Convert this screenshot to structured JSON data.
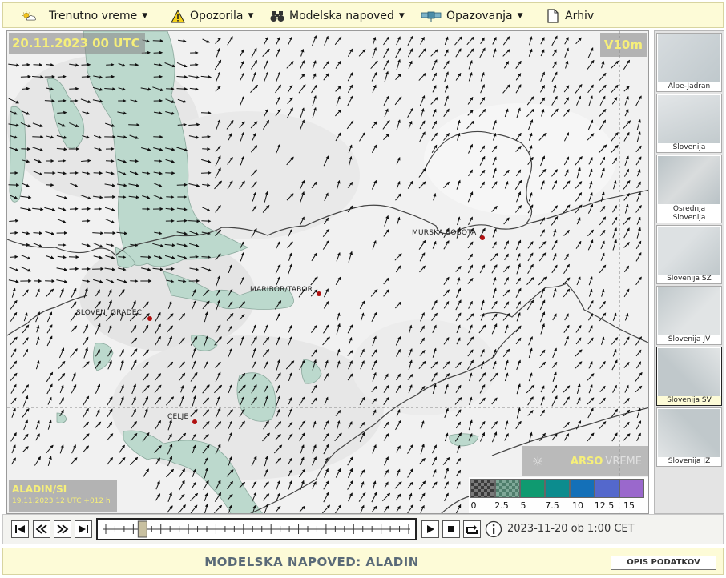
{
  "menu": {
    "items": [
      {
        "label": "Trenutno vreme",
        "icon": "weather-sun-cloud-icon",
        "dropdown": true
      },
      {
        "label": "Opozorila",
        "icon": "warning-triangle-icon",
        "dropdown": true
      },
      {
        "label": "Modelska napoved",
        "icon": "binoculars-icon",
        "dropdown": true
      },
      {
        "label": "Opazovanja",
        "icon": "observation-satellite-icon",
        "dropdown": true
      },
      {
        "label": "Arhiv",
        "icon": "document-icon",
        "dropdown": false
      }
    ]
  },
  "map": {
    "timestamp": "20.11.2023 00 UTC",
    "variable": "V10m",
    "model": "ALADIN/SI",
    "model_run": "19.11.2023 12 UTC +012 h",
    "logo_brand": "ARSO",
    "logo_word": "VREME",
    "cities": [
      "MURSKA SOBOTA",
      "MARIBOR/TABOR",
      "SLOVENJ GRADEC",
      "CELJE"
    ]
  },
  "legend": {
    "labels": [
      "0",
      "2.5",
      "5",
      "7.5",
      "10",
      "12.5",
      "15"
    ],
    "colors": [
      "#5a5a5a",
      "#5e8c7a",
      "#0f9a70",
      "#0c8c8e",
      "#1470b8",
      "#5468cc",
      "#9a68cc"
    ]
  },
  "thumbnails": [
    {
      "label": "Alpe-Jadran",
      "selected": false
    },
    {
      "label": "Slovenija",
      "selected": false
    },
    {
      "label": "Osrednja Slovenija",
      "selected": false
    },
    {
      "label": "Slovenija SZ",
      "selected": false
    },
    {
      "label": "Slovenija JV",
      "selected": false
    },
    {
      "label": "Slovenija SV",
      "selected": true
    },
    {
      "label": "Slovenija JZ",
      "selected": false
    }
  ],
  "player": {
    "datetime": "2023-11-20 ob 1:00 CET",
    "frame_count": 34,
    "current_frame": 4
  },
  "footer": {
    "title": "MODELSKA NAPOVED: ALADIN",
    "info_button": "OPIS PODATKOV"
  }
}
